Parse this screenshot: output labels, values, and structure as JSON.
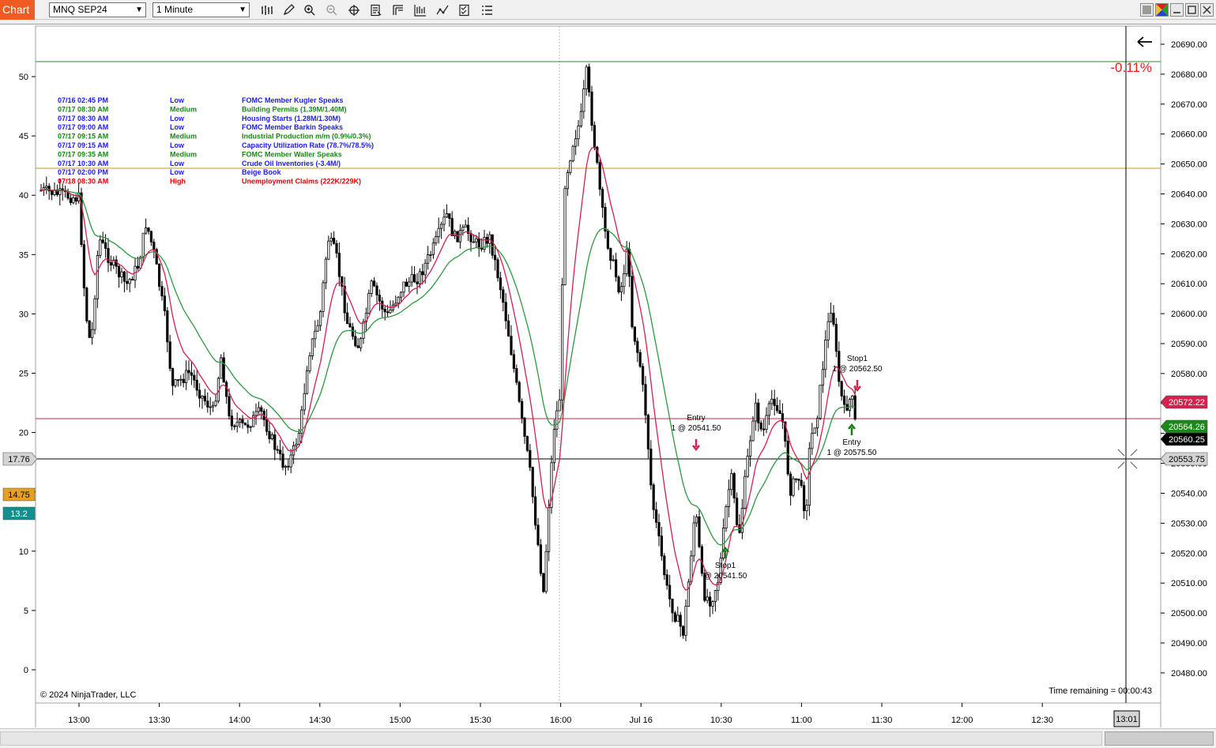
{
  "toolbar": {
    "tab_label": "Chart",
    "instrument": "MNQ SEP24",
    "interval": "1 Minute"
  },
  "colors": {
    "up_candle": "#ffffff",
    "down_candle": "#000000",
    "ema_fast": "#d6204e",
    "ema_slow": "#2c9a3c",
    "buy_marker": "#1a7a1a",
    "sell_marker": "#d6204e"
  },
  "chart": {
    "pct_change": "-0.11%",
    "copyright": "© 2024 NinjaTrader, LLC",
    "time_remaining": "Time remaining = 00:00:43",
    "cursor_time": "13:01",
    "time_labels": [
      "13:00",
      "13:30",
      "14:00",
      "14:30",
      "15:00",
      "15:30",
      "16:00",
      "Jul 16",
      "10:30",
      "11:00",
      "11:30",
      "12:00",
      "12:30"
    ],
    "right_ticks": [
      "20690.00",
      "20680.00",
      "20670.00",
      "20660.00",
      "20650.00",
      "20640.00",
      "20630.00",
      "20620.00",
      "20610.00",
      "20600.00",
      "20590.00",
      "20580.00",
      "20570.00",
      "20560.00",
      "20550.00",
      "20540.00",
      "20530.00",
      "20520.00",
      "20510.00",
      "20500.00",
      "20490.00",
      "20480.00"
    ],
    "left_ticks": [
      "50",
      "45",
      "40",
      "35",
      "30",
      "25",
      "20",
      "15",
      "10",
      "5",
      "0"
    ],
    "price_flags": [
      {
        "label": "20572.22",
        "color": "#d6204e",
        "text": "#ffffff"
      },
      {
        "label": "20564.26",
        "color": "#178a17",
        "text": "#ffffff"
      },
      {
        "label": "20560.25",
        "color": "#000000",
        "text": "#ffffff"
      },
      {
        "label": "20553.75",
        "color": "#d4d4d4",
        "text": "#000000"
      }
    ],
    "left_flags": [
      {
        "label": "17.76",
        "color": "#d4d4d4",
        "text": "#000000"
      },
      {
        "label": "14.75",
        "color": "#e6a020",
        "text": "#000000"
      },
      {
        "label": "13.2",
        "color": "#108f8f",
        "text": "#ffffff"
      }
    ]
  },
  "events": [
    {
      "time": "07/16 02:45 PM",
      "impact": "Low",
      "name": "FOMC Member Kugler Speaks",
      "color": "#1a1aff"
    },
    {
      "time": "07/17 08:30 AM",
      "impact": "Medium",
      "name": "Building Permits (1.39M/1.40M)",
      "color": "#158a15"
    },
    {
      "time": "07/17 08:30 AM",
      "impact": "Low",
      "name": "Housing Starts (1.28M/1.30M)",
      "color": "#1a1aff"
    },
    {
      "time": "07/17 09:00 AM",
      "impact": "Low",
      "name": "FOMC Member Barkin Speaks",
      "color": "#1a1aff"
    },
    {
      "time": "07/17 09:15 AM",
      "impact": "Medium",
      "name": "Industrial Production m/m (0.9%/0.3%)",
      "color": "#158a15"
    },
    {
      "time": "07/17 09:15 AM",
      "impact": "Low",
      "name": "Capacity Utilization Rate (78.7%/78.5%)",
      "color": "#1a1aff"
    },
    {
      "time": "07/17 09:35 AM",
      "impact": "Medium",
      "name": "FOMC Member Waller Speaks",
      "color": "#158a15"
    },
    {
      "time": "07/17 10:30 AM",
      "impact": "Low",
      "name": "Crude Oil Inventories (-3.4M/)",
      "color": "#1a1aff"
    },
    {
      "time": "07/17 02:00 PM",
      "impact": "Low",
      "name": "Beige Book",
      "color": "#1a1aff"
    },
    {
      "time": "07/18 08:30 AM",
      "impact": "High",
      "name": "Unemployment Claims (222K/229K)",
      "color": "#e60000"
    }
  ],
  "trade_labels": [
    {
      "title": "Entry",
      "detail": "1 @ 20541.50",
      "side": "sell"
    },
    {
      "title": "Stop1",
      "detail": "@ 20541.50",
      "side": "buy"
    },
    {
      "title": "Stop1",
      "detail": "1 @ 20562.50",
      "side": "sell"
    },
    {
      "title": "Entry",
      "detail": "1 @ 20575.50",
      "side": "buy"
    }
  ]
}
